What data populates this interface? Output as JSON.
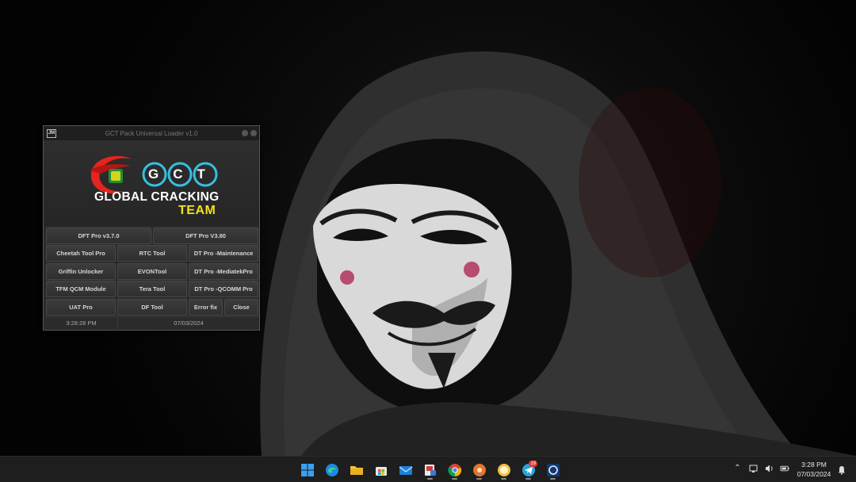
{
  "app_window": {
    "title": "GCT Pack Universal Loader v1.0",
    "icon_text": "JM",
    "logo": {
      "monogram": "GCT",
      "brand_line1": "GLOBAL CRACKING",
      "brand_line2": "TEAM"
    },
    "buttons": [
      [
        "DFT Pro v3.7.0",
        "DFT Pro V3.80"
      ],
      [
        "Cheetah Tool Pro",
        "RTC Tool",
        "DT Pro -Maintenance"
      ],
      [
        "Griffin Unlocker",
        "EVONTool",
        "DT Pro -MediatekPro"
      ],
      [
        "TFM QCM Module",
        "Tera Tool",
        "DT Pro -QCOMM Pro"
      ],
      [
        "UAT Pro",
        "DF Tool",
        "Error fix",
        "Close"
      ]
    ],
    "status": {
      "time": "3:28:28 PM",
      "date": "07/03/2024"
    }
  },
  "taskbar": {
    "apps": [
      "start",
      "edge",
      "file-explorer",
      "microsoft-store",
      "mail",
      "snipping-tool",
      "chrome",
      "app-orange",
      "app-coin",
      "telegram",
      "app-blue"
    ],
    "telegram_badge": "19",
    "clock": {
      "time": "3:28 PM",
      "date": "07/03/2024"
    }
  },
  "colors": {
    "accent_red": "#e52420",
    "accent_cyan": "#35c0e0",
    "accent_yellow": "#f2e21a",
    "window_bg": "#2b2b2b"
  }
}
